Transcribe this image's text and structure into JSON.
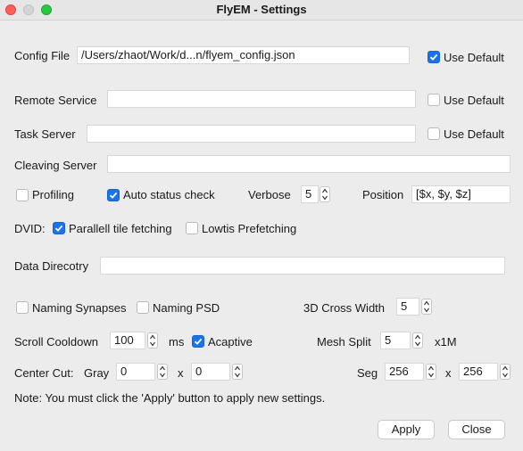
{
  "window": {
    "title": "FlyEM - Settings"
  },
  "config_file": {
    "label": "Config File",
    "value": "/Users/zhaot/Work/d...n/flyem_config.json",
    "use_default_label": "Use Default",
    "use_default_checked": true
  },
  "remote_service": {
    "label": "Remote Service",
    "value": "",
    "use_default_label": "Use Default",
    "use_default_checked": false
  },
  "task_server": {
    "label": "Task Server",
    "value": "",
    "use_default_label": "Use Default",
    "use_default_checked": false
  },
  "cleaving_server": {
    "label": "Cleaving Server",
    "value": ""
  },
  "profiling": {
    "label": "Profiling",
    "checked": false
  },
  "auto_status": {
    "label": "Auto status check",
    "checked": true
  },
  "verbose": {
    "label": "Verbose",
    "value": "5"
  },
  "position": {
    "label": "Position",
    "value": "[$x, $y, $z]"
  },
  "dvid": {
    "label": "DVID:",
    "parallel_label": "Parallell tile fetching",
    "parallel_checked": true,
    "lowtis_label": "Lowtis Prefetching",
    "lowtis_checked": false
  },
  "data_directory": {
    "label": "Data Direcotry",
    "value": ""
  },
  "naming_synapses": {
    "label": "Naming Synapses",
    "checked": false
  },
  "naming_psd": {
    "label": "Naming PSD",
    "checked": false
  },
  "cross_width": {
    "label": "3D Cross Width",
    "value": "5"
  },
  "scroll_cooldown": {
    "label": "Scroll Cooldown",
    "value": "100",
    "unit": "ms"
  },
  "acaptive": {
    "label": "Acaptive",
    "checked": true
  },
  "mesh_split": {
    "label": "Mesh Split",
    "value": "5",
    "unit": "x1M"
  },
  "center_cut": {
    "label": "Center Cut:",
    "gray_label": "Gray",
    "gray_x": "0",
    "times": "x",
    "gray_y": "0",
    "seg_label": "Seg",
    "seg_x": "256",
    "seg_y": "256"
  },
  "note": "Note: You must click the 'Apply' button to apply new settings.",
  "buttons": {
    "apply": "Apply",
    "close": "Close"
  },
  "colors": {
    "accent": "#1a73e8",
    "background": "#ececec"
  }
}
